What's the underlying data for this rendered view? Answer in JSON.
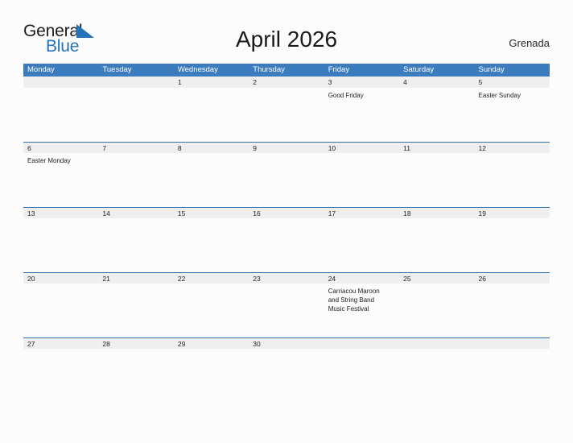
{
  "brand": {
    "name_part1": "General",
    "name_part2": "Blue",
    "flag_icon": "triangle-flag-icon",
    "accent_color": "#2573b8"
  },
  "header": {
    "title": "April 2026",
    "country": "Grenada"
  },
  "colors": {
    "header_blue": "#3b7cbe",
    "row_divider_blue": "#2f6fad",
    "date_band_gray": "#efefef",
    "page_background": "#fcfcfc",
    "text": "#222222"
  },
  "calendar": {
    "weekdays": [
      "Monday",
      "Tuesday",
      "Wednesday",
      "Thursday",
      "Friday",
      "Saturday",
      "Sunday"
    ],
    "weeks": [
      {
        "days": [
          {
            "date": "",
            "events": []
          },
          {
            "date": "",
            "events": []
          },
          {
            "date": "1",
            "events": []
          },
          {
            "date": "2",
            "events": []
          },
          {
            "date": "3",
            "events": [
              "Good Friday"
            ]
          },
          {
            "date": "4",
            "events": []
          },
          {
            "date": "5",
            "events": [
              "Easter Sunday"
            ]
          }
        ]
      },
      {
        "days": [
          {
            "date": "6",
            "events": [
              "Easter Monday"
            ]
          },
          {
            "date": "7",
            "events": []
          },
          {
            "date": "8",
            "events": []
          },
          {
            "date": "9",
            "events": []
          },
          {
            "date": "10",
            "events": []
          },
          {
            "date": "11",
            "events": []
          },
          {
            "date": "12",
            "events": []
          }
        ]
      },
      {
        "days": [
          {
            "date": "13",
            "events": []
          },
          {
            "date": "14",
            "events": []
          },
          {
            "date": "15",
            "events": []
          },
          {
            "date": "16",
            "events": []
          },
          {
            "date": "17",
            "events": []
          },
          {
            "date": "18",
            "events": []
          },
          {
            "date": "19",
            "events": []
          }
        ]
      },
      {
        "days": [
          {
            "date": "20",
            "events": []
          },
          {
            "date": "21",
            "events": []
          },
          {
            "date": "22",
            "events": []
          },
          {
            "date": "23",
            "events": []
          },
          {
            "date": "24",
            "events": [
              "Carriacou Maroon",
              "and String Band",
              "Music Festival"
            ]
          },
          {
            "date": "25",
            "events": []
          },
          {
            "date": "26",
            "events": []
          }
        ]
      },
      {
        "days": [
          {
            "date": "27",
            "events": []
          },
          {
            "date": "28",
            "events": []
          },
          {
            "date": "29",
            "events": []
          },
          {
            "date": "30",
            "events": []
          },
          {
            "date": "",
            "events": []
          },
          {
            "date": "",
            "events": []
          },
          {
            "date": "",
            "events": []
          }
        ]
      }
    ]
  }
}
